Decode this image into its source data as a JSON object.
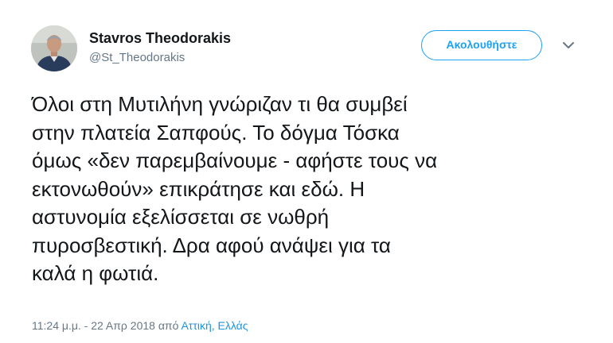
{
  "author": {
    "name": "Stavros Theodorakis",
    "handle": "@St_Theodorakis"
  },
  "actions": {
    "follow_label": "Ακολουθήστε",
    "menu_icon": "chevron-down-icon"
  },
  "tweet": {
    "lines": [
      "Όλοι στη Μυτιλήνη γνώριζαν τι θα συμβεί",
      "στην πλατεία Σαπφούς. Το δόγμα Τόσκα",
      "όμως «δεν παρεμβαίνουμε - αφήστε τους να",
      "εκτονωθούν» επικράτησε και εδώ. Η",
      "αστυνομία εξελίσσεται σε νωθρή",
      "πυροσβεστική. Δρα αφού ανάψει για τα",
      "καλά η φωτιά."
    ]
  },
  "meta": {
    "timestamp": "11:24 μ.μ. - 22 Απρ 2018 από ",
    "location": "Αττική, Ελλάς"
  },
  "colors": {
    "accent": "#1da1f2",
    "text": "#14171a",
    "secondary": "#657786"
  }
}
